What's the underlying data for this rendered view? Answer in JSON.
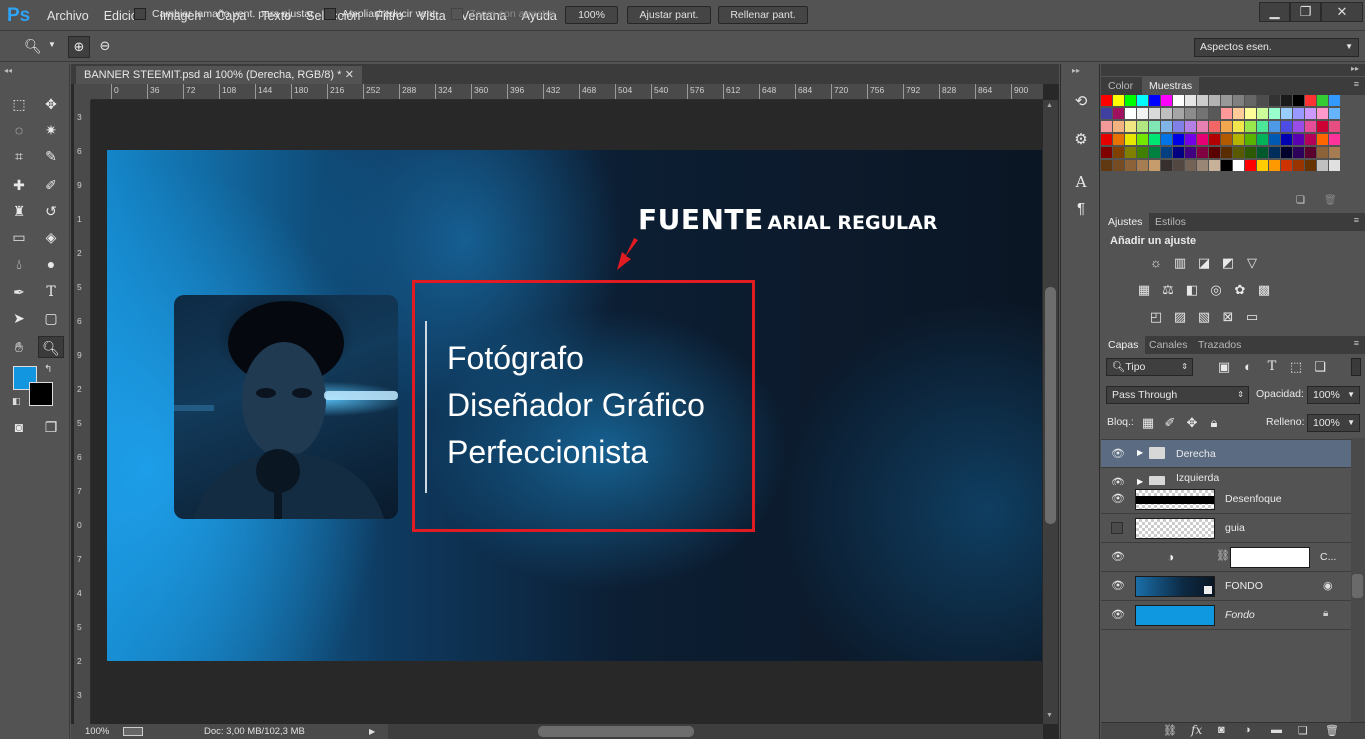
{
  "app": {
    "logo": "Ps"
  },
  "menu": [
    "Archivo",
    "Edición",
    "Imagen",
    "Capa",
    "Texto",
    "Selección",
    "Filtro",
    "Vista",
    "Ventana",
    "Ayuda"
  ],
  "window_controls": {
    "minimize": "▁",
    "restore": "❐",
    "close": "✕"
  },
  "options": {
    "resize_windows": "Cambiar tamaño vent. para ajustar",
    "zoom_all": "Ampliar/reducir vent.",
    "scrubby_zoom": "Zoom con arrastre",
    "zoom_value": "100%",
    "fit_screen": "Ajustar pant.",
    "fill_screen": "Rellenar pant.",
    "workspace": "Aspectos esen."
  },
  "document": {
    "tab_title": "BANNER STEEMIT.psd al 100% (Derecha, RGB/8) *",
    "ruler_h": [
      "0",
      "36",
      "72",
      "108",
      "144",
      "180",
      "216",
      "252",
      "288",
      "324",
      "360",
      "396",
      "432",
      "468",
      "504",
      "540",
      "576",
      "612",
      "648",
      "684",
      "720",
      "756",
      "792",
      "828",
      "864",
      "900"
    ],
    "ruler_v": [
      "3",
      "6",
      "9",
      "1",
      "2",
      "5",
      "6",
      "9",
      "2",
      "5",
      "6",
      "7",
      "0",
      "7",
      "4",
      "5",
      "2",
      "3"
    ],
    "status_zoom": "100%",
    "status_doc": "Doc: 3,00 MB/102,3 MB"
  },
  "canvas": {
    "lines": [
      "Fotógrafo",
      "Diseñador Gráfico",
      "Perfeccionista"
    ],
    "annotation_big": "FUENTE",
    "annotation_small": "ARIAL REGULAR",
    "colors": {
      "highlight_box": "#e01b22",
      "arrow": "#e01b22"
    }
  },
  "colors": {
    "foreground": "#1296e0",
    "background": "#000000"
  },
  "panels": {
    "color_tabs": [
      "Color",
      "Muestras"
    ],
    "adjust_tabs": [
      "Ajustes",
      "Estilos"
    ],
    "adjust_title": "Añadir un ajuste",
    "layer_tabs": [
      "Capas",
      "Canales",
      "Trazados"
    ],
    "filter_kind": "Tipo",
    "blend_mode": "Pass Through",
    "opacity_label": "Opacidad:",
    "opacity_value": "100%",
    "lock_label": "Bloq.:",
    "fill_label": "Relleno:",
    "fill_value": "100%",
    "layers": [
      {
        "name": "Derecha"
      },
      {
        "name": "Izquierda"
      },
      {
        "name": "Desenfoque"
      },
      {
        "name": "guia"
      },
      {
        "name": "C..."
      },
      {
        "name": "FONDO"
      },
      {
        "name": "Fondo"
      }
    ]
  }
}
